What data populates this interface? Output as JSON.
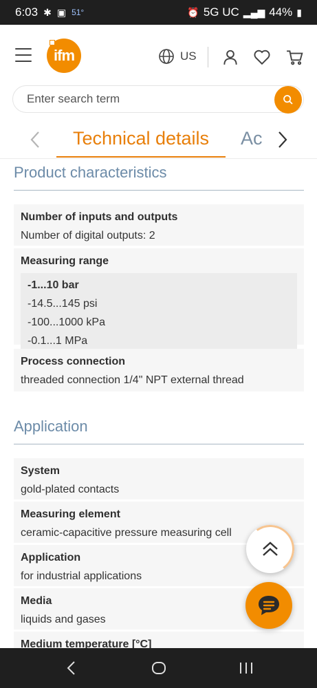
{
  "status_bar": {
    "time": "6:03",
    "temperature": "51°",
    "network": "5G UC",
    "battery": "44%"
  },
  "header": {
    "logo_text": "ifm",
    "region": "US",
    "search": {
      "placeholder": "Enter search term"
    },
    "accent_color": "#f28c00"
  },
  "tabs": {
    "active": "Technical details",
    "next": "Ac"
  },
  "sections": {
    "product_characteristics": {
      "title": "Product characteristics",
      "rows": [
        {
          "label": "Number of inputs and outputs",
          "value": "Number of digital outputs: 2"
        },
        {
          "label": "Measuring range",
          "values": [
            "-1...10 bar",
            "-14.5...145 psi",
            "-100...1000 kPa",
            "-0.1...1 MPa"
          ]
        },
        {
          "label": "Process connection",
          "value": "threaded connection 1/4\" NPT external thread"
        }
      ]
    },
    "application": {
      "title": "Application",
      "rows": [
        {
          "label": "System",
          "value": "gold-plated contacts"
        },
        {
          "label": "Measuring element",
          "value": "ceramic-capacitive pressure measuring cell"
        },
        {
          "label": "Application",
          "value": "for industrial applications"
        },
        {
          "label": "Media",
          "value": "liquids and gases"
        },
        {
          "label": "Medium temperature [°C]",
          "value": ""
        }
      ]
    }
  },
  "icons": {
    "menu": "hamburger-icon",
    "globe": "globe-icon",
    "user": "user-icon",
    "wishlist": "heart-icon",
    "cart": "cart-icon",
    "search": "search-icon",
    "scroll_top": "chevron-up-icon",
    "chat": "chat-icon"
  }
}
